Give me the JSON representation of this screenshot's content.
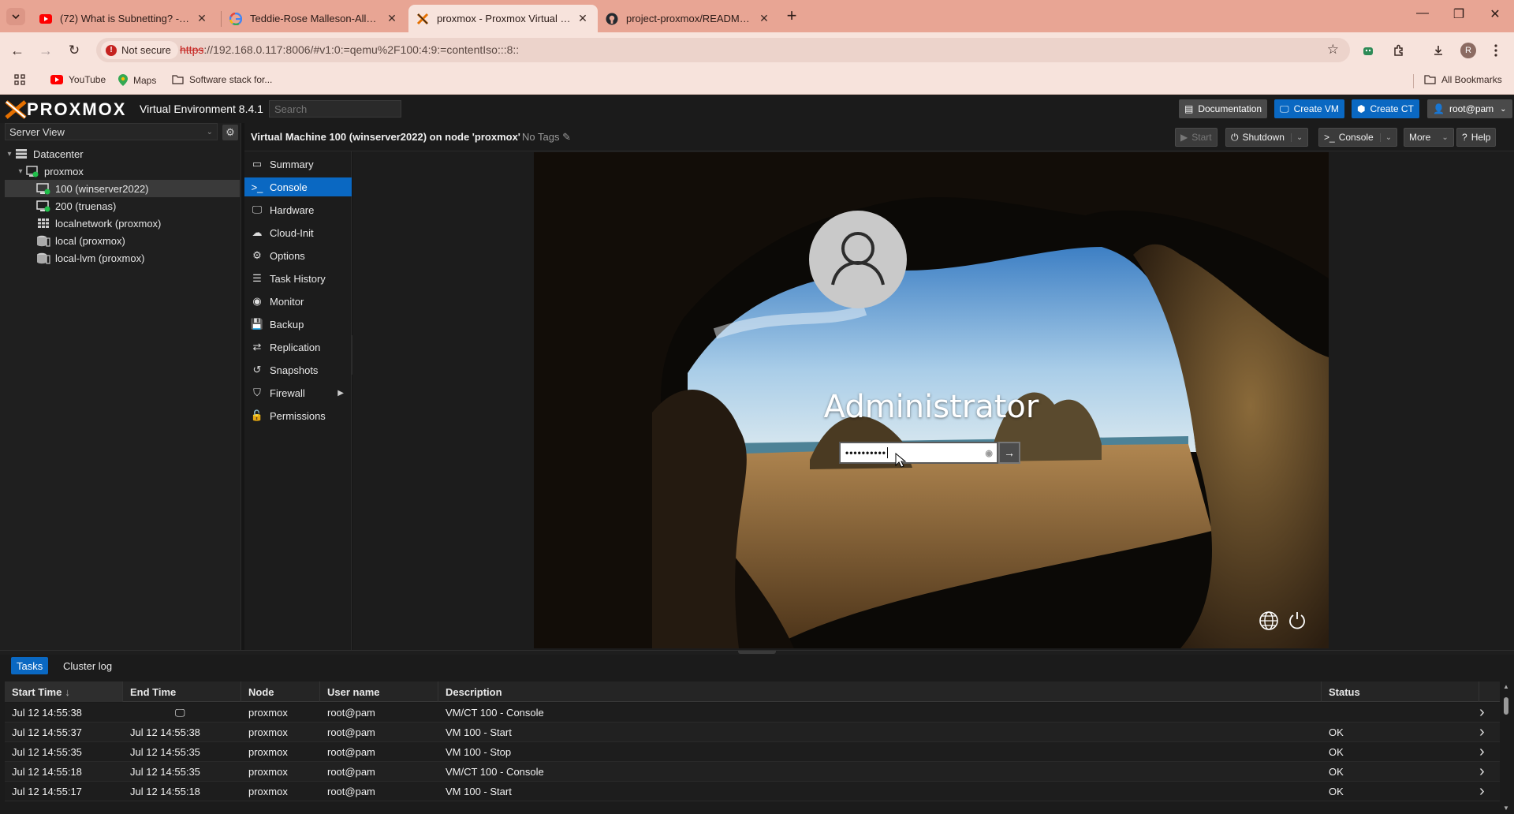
{
  "browser": {
    "tabs": [
      {
        "title": "(72) What is Subnetting? - Subn",
        "icon": "youtube-icon"
      },
      {
        "title": "Teddie-Rose Malleson-Allen - G",
        "icon": "google-icon"
      },
      {
        "title": "proxmox - Proxmox Virtual Envi",
        "icon": "proxmox-icon",
        "active": true
      },
      {
        "title": "project-proxmox/README.md a",
        "icon": "github-icon"
      }
    ],
    "address": {
      "security_label": "Not secure",
      "url_scheme": "https",
      "url_rest": "://192.168.0.117:8006/#v1:0:=qemu%2F100:4:9:=contentIso:::8::"
    },
    "profile_initial": "R",
    "bookmarks": [
      {
        "label": "YouTube",
        "icon": "youtube-icon"
      },
      {
        "label": "Maps",
        "icon": "maps-icon"
      },
      {
        "label": "Software stack for...",
        "icon": "folder-icon"
      }
    ],
    "all_bookmarks_label": "All Bookmarks"
  },
  "pve": {
    "logo_text": "PROXMOX",
    "version": "Virtual Environment 8.4.1",
    "search_placeholder": "Search",
    "header_buttons": {
      "documentation": "Documentation",
      "create_vm": "Create VM",
      "create_ct": "Create CT",
      "user": "root@pam"
    },
    "view_label": "Server View",
    "tree": [
      {
        "label": "Datacenter",
        "icon": "datacenter-icon",
        "level": 0
      },
      {
        "label": "proxmox",
        "icon": "node-icon",
        "level": 1
      },
      {
        "label": "100 (winserver2022)",
        "icon": "vm-running-icon",
        "level": 2,
        "selected": true
      },
      {
        "label": "200 (truenas)",
        "icon": "vm-running-icon",
        "level": 2
      },
      {
        "label": "localnetwork (proxmox)",
        "icon": "network-icon",
        "level": 2
      },
      {
        "label": "local (proxmox)",
        "icon": "storage-icon",
        "level": 2
      },
      {
        "label": "local-lvm (proxmox)",
        "icon": "storage-icon",
        "level": 2
      }
    ],
    "content_title": "Virtual Machine 100 (winserver2022) on node 'proxmox'",
    "no_tags": "No Tags",
    "toolbar": {
      "start": "Start",
      "shutdown": "Shutdown",
      "console": "Console",
      "more": "More",
      "help": "Help"
    },
    "menu": [
      {
        "label": "Summary",
        "icon": "summary-icon"
      },
      {
        "label": "Console",
        "icon": "console-icon",
        "active": true
      },
      {
        "label": "Hardware",
        "icon": "hardware-icon"
      },
      {
        "label": "Cloud-Init",
        "icon": "cloud-icon"
      },
      {
        "label": "Options",
        "icon": "gear-icon"
      },
      {
        "label": "Task History",
        "icon": "list-icon"
      },
      {
        "label": "Monitor",
        "icon": "eye-icon"
      },
      {
        "label": "Backup",
        "icon": "floppy-icon"
      },
      {
        "label": "Replication",
        "icon": "retweet-icon"
      },
      {
        "label": "Snapshots",
        "icon": "history-icon"
      },
      {
        "label": "Firewall",
        "icon": "shield-icon",
        "has_submenu": true
      },
      {
        "label": "Permissions",
        "icon": "unlock-icon"
      }
    ],
    "vm_console": {
      "username": "Administrator",
      "password_mask": "••••••••••"
    },
    "log_tabs": [
      "Tasks",
      "Cluster log"
    ],
    "tasks": {
      "columns": [
        "Start Time",
        "End Time",
        "Node",
        "User name",
        "Description",
        "Status"
      ],
      "sorted_column": "Start Time",
      "rows": [
        {
          "start": "Jul 12 14:55:38",
          "end": "",
          "end_icon": "monitor-icon",
          "node": "proxmox",
          "user": "root@pam",
          "desc": "VM/CT 100 - Console",
          "status": ""
        },
        {
          "start": "Jul 12 14:55:37",
          "end": "Jul 12 14:55:38",
          "node": "proxmox",
          "user": "root@pam",
          "desc": "VM 100 - Start",
          "status": "OK"
        },
        {
          "start": "Jul 12 14:55:35",
          "end": "Jul 12 14:55:35",
          "node": "proxmox",
          "user": "root@pam",
          "desc": "VM 100 - Stop",
          "status": "OK"
        },
        {
          "start": "Jul 12 14:55:18",
          "end": "Jul 12 14:55:35",
          "node": "proxmox",
          "user": "root@pam",
          "desc": "VM/CT 100 - Console",
          "status": "OK"
        },
        {
          "start": "Jul 12 14:55:17",
          "end": "Jul 12 14:55:18",
          "node": "proxmox",
          "user": "root@pam",
          "desc": "VM 100 - Start",
          "status": "OK"
        }
      ]
    }
  },
  "colors": {
    "accent": "#0a68c2",
    "browser_frame": "#e8a594",
    "browser_toolbar": "#f7e3dc",
    "pve_bg": "#1b1b1b"
  }
}
